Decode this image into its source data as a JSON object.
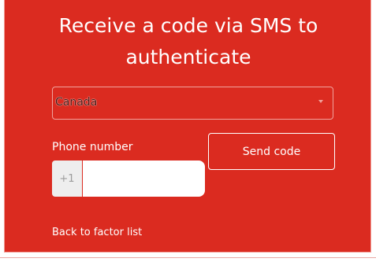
{
  "auth": {
    "title": "Receive a code via SMS to authenticate",
    "country": {
      "selected": "Canada"
    },
    "phone": {
      "label": "Phone number",
      "prefix": "+1",
      "value": "",
      "placeholder": ""
    },
    "send_button": "Send code",
    "back_link": "Back to factor list"
  },
  "colors": {
    "panel_background": "#db2b20",
    "text": "#ffffff",
    "input_background": "#ffffff",
    "prefix_background": "#eeeeee"
  },
  "icons": {
    "country_dropdown": "chevron-down-icon"
  }
}
